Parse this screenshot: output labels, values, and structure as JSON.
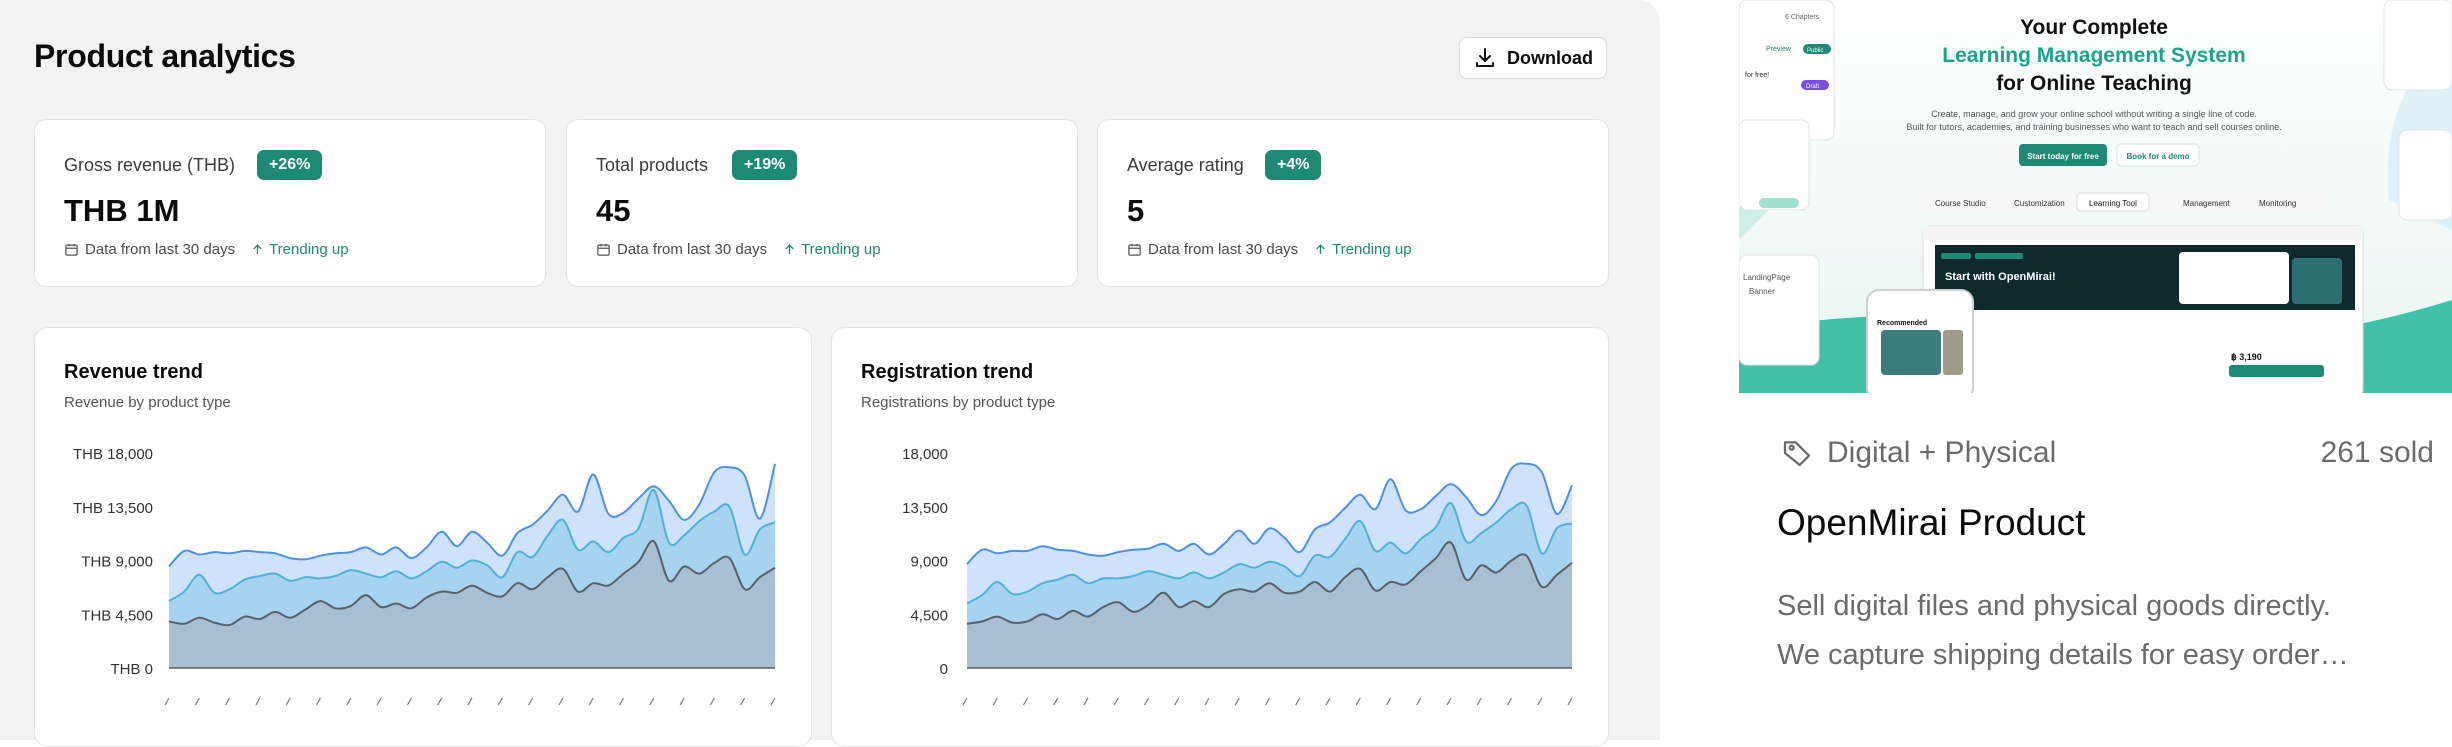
{
  "header": {
    "title": "Product analytics",
    "download_label": "Download"
  },
  "stats": [
    {
      "label": "Gross revenue (THB)",
      "badge": "+26%",
      "value": "THB 1M",
      "period": "Data from last 30 days",
      "trend": "Trending up"
    },
    {
      "label": "Total products",
      "badge": "+19%",
      "value": "45",
      "period": "Data from last 30 days",
      "trend": "Trending up"
    },
    {
      "label": "Average rating",
      "badge": "+4%",
      "value": "5",
      "period": "Data from last 30 days",
      "trend": "Trending up"
    }
  ],
  "colors": {
    "accent": "#1e8a73",
    "series_top": "#4d90e8",
    "series_mid": "#4fb2d6",
    "series_bottom": "#5a6068"
  },
  "chart_data": [
    {
      "type": "area",
      "title": "Revenue trend",
      "subtitle": "Revenue by product type",
      "yticks": [
        "THB 18,000",
        "THB 13,500",
        "THB 9,000",
        "THB 4,500",
        "THB 0"
      ],
      "ylim": [
        0,
        18000
      ],
      "grid": false,
      "series": [
        {
          "values": [
            3900,
            3700,
            4200,
            3800,
            3600,
            4300,
            4100,
            4700,
            4200,
            4900,
            5600,
            5000,
            5200,
            6100,
            5100,
            5400,
            5000,
            5900,
            6400,
            6300,
            6900,
            6300,
            6000,
            7100,
            6600,
            7600,
            8300,
            6400,
            7100,
            6900,
            7900,
            8900,
            10600,
            7300,
            8500,
            7900,
            8800,
            9200,
            6600,
            7600,
            8400
          ]
        },
        {
          "values": [
            5600,
            6400,
            7800,
            6300,
            6600,
            7400,
            7700,
            7900,
            7300,
            7600,
            7500,
            7700,
            8200,
            7900,
            7600,
            8100,
            7500,
            8100,
            8900,
            8400,
            9000,
            8600,
            7600,
            9700,
            9300,
            11100,
            12400,
            9900,
            10600,
            9700,
            10900,
            11700,
            14900,
            10500,
            11100,
            12300,
            13100,
            13500,
            9500,
            11600,
            12200
          ]
        },
        {
          "values": [
            8500,
            9800,
            9500,
            9700,
            9600,
            9800,
            9700,
            9600,
            9200,
            9100,
            9400,
            9600,
            9700,
            10100,
            9500,
            10100,
            9200,
            10100,
            11400,
            10200,
            11400,
            10500,
            9400,
            11300,
            12000,
            13200,
            14500,
            13100,
            16200,
            12900,
            13000,
            14200,
            15200,
            14000,
            12400,
            13700,
            16400,
            16800,
            16100,
            12500,
            17100
          ]
        }
      ]
    },
    {
      "type": "area",
      "title": "Registration trend",
      "subtitle": "Registrations by product type",
      "yticks": [
        "18,000",
        "13,500",
        "9,000",
        "4,500",
        "0"
      ],
      "ylim": [
        0,
        18000
      ],
      "grid": false,
      "series": [
        {
          "values": [
            3700,
            3900,
            4300,
            3800,
            3900,
            4500,
            4100,
            4800,
            4300,
            5100,
            5500,
            4700,
            5300,
            6300,
            5100,
            5600,
            5100,
            6200,
            6600,
            6400,
            7100,
            6300,
            6400,
            7200,
            6400,
            7600,
            8300,
            6500,
            7200,
            7000,
            8100,
            9200,
            10500,
            7400,
            8600,
            8000,
            9000,
            9400,
            6800,
            7800,
            8800
          ]
        },
        {
          "values": [
            5400,
            6100,
            7200,
            6200,
            6400,
            7100,
            7400,
            7800,
            7100,
            7500,
            7500,
            7700,
            8100,
            7800,
            7500,
            8000,
            7500,
            8000,
            8700,
            8400,
            8900,
            8500,
            7700,
            9400,
            9300,
            10800,
            12300,
            9800,
            10500,
            9600,
            10800,
            11800,
            13800,
            10600,
            11300,
            12200,
            13300,
            13600,
            9600,
            11700,
            12100
          ]
        },
        {
          "values": [
            8700,
            9900,
            9600,
            9800,
            9800,
            10200,
            9900,
            9800,
            9500,
            9400,
            9700,
            9900,
            10000,
            10400,
            9800,
            10400,
            9500,
            10400,
            11500,
            10400,
            11700,
            10900,
            9700,
            11600,
            12200,
            13400,
            14500,
            13300,
            15800,
            13200,
            13300,
            14400,
            15400,
            14300,
            12800,
            14000,
            16700,
            17100,
            16400,
            12900,
            15300
          ]
        }
      ]
    }
  ],
  "product": {
    "category": "Digital + Physical",
    "sold": "261 sold",
    "name": "OpenMirai Product",
    "desc_line1": "Sell digital files and physical goods directly.",
    "desc_line2": "We capture shipping details for easy order…"
  },
  "hero": {
    "heading1": "Your Complete",
    "heading2": "Learning Management System",
    "heading3": "for Online Teaching",
    "sub1": "Create, manage, and grow your online school without writing a single line of code.",
    "sub2": "Built for tutors, academies, and training businesses who want to teach and sell courses online.",
    "cta1": "Start today for free",
    "cta2": "Book for a demo",
    "tabs": [
      "Course Studio",
      "Customization",
      "Learning Tool",
      "Management",
      "Monitoring"
    ],
    "inner_title": "Start with OpenMirai!",
    "inner_recommended": "Recommended",
    "inner_price": "฿ 3,190",
    "left_chapters": "6 Chapters",
    "left_preview": "Preview",
    "left_public": "Public",
    "left_free": "for free!",
    "left_draft": "Draft",
    "left_landing": "LandingPage",
    "left_banner": "Banner"
  }
}
